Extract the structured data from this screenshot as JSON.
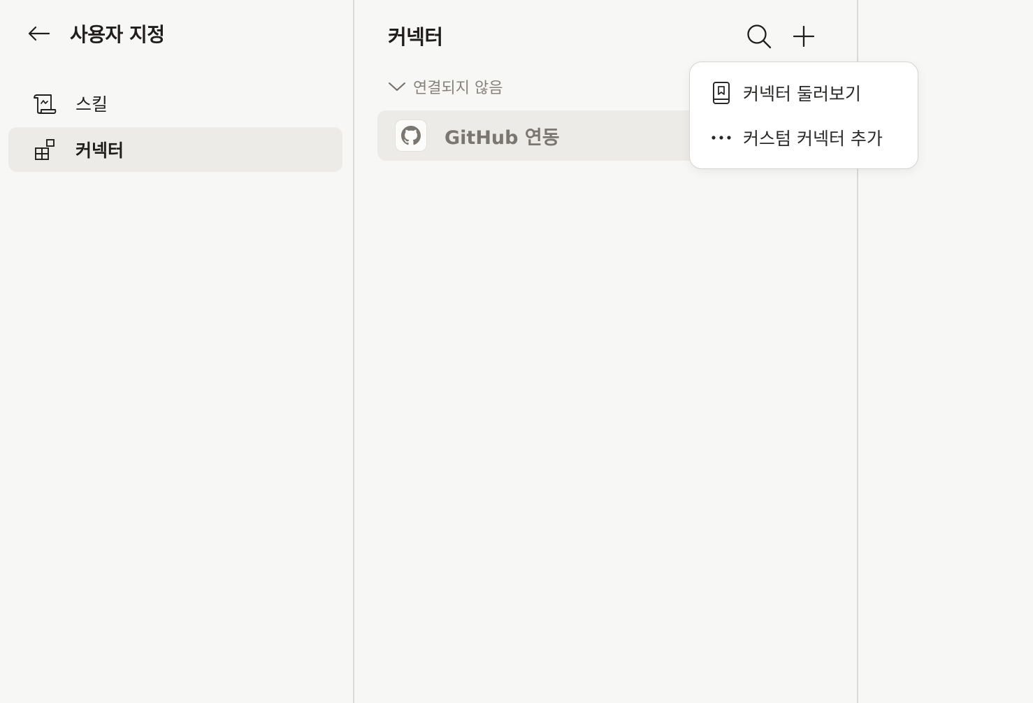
{
  "sidebar": {
    "title": "사용자 지정",
    "back_icon": "arrow-left-icon",
    "items": [
      {
        "label": "스킬",
        "icon": "scroll-icon",
        "active": false
      },
      {
        "label": "커넥터",
        "icon": "connector-blocks-icon",
        "active": true
      }
    ]
  },
  "main": {
    "title": "커넥터",
    "search_icon": "search-icon",
    "add_icon": "plus-icon",
    "group": {
      "label": "연결되지 않음",
      "icon": "chevron-down-icon",
      "expanded": true
    },
    "connectors": [
      {
        "name": "GitHub 연동",
        "icon": "github-icon"
      }
    ]
  },
  "add_menu": {
    "open": true,
    "items": [
      {
        "label": "커넥터 둘러보기",
        "icon": "book-icon"
      },
      {
        "label": "커스텀 커넥터 추가",
        "icon": "more-horizontal-icon"
      }
    ]
  },
  "colors": {
    "background": "#f7f7f5",
    "active_item": "#ecebe7",
    "menu_bg": "#ffffff",
    "muted_text": "#86837d"
  }
}
